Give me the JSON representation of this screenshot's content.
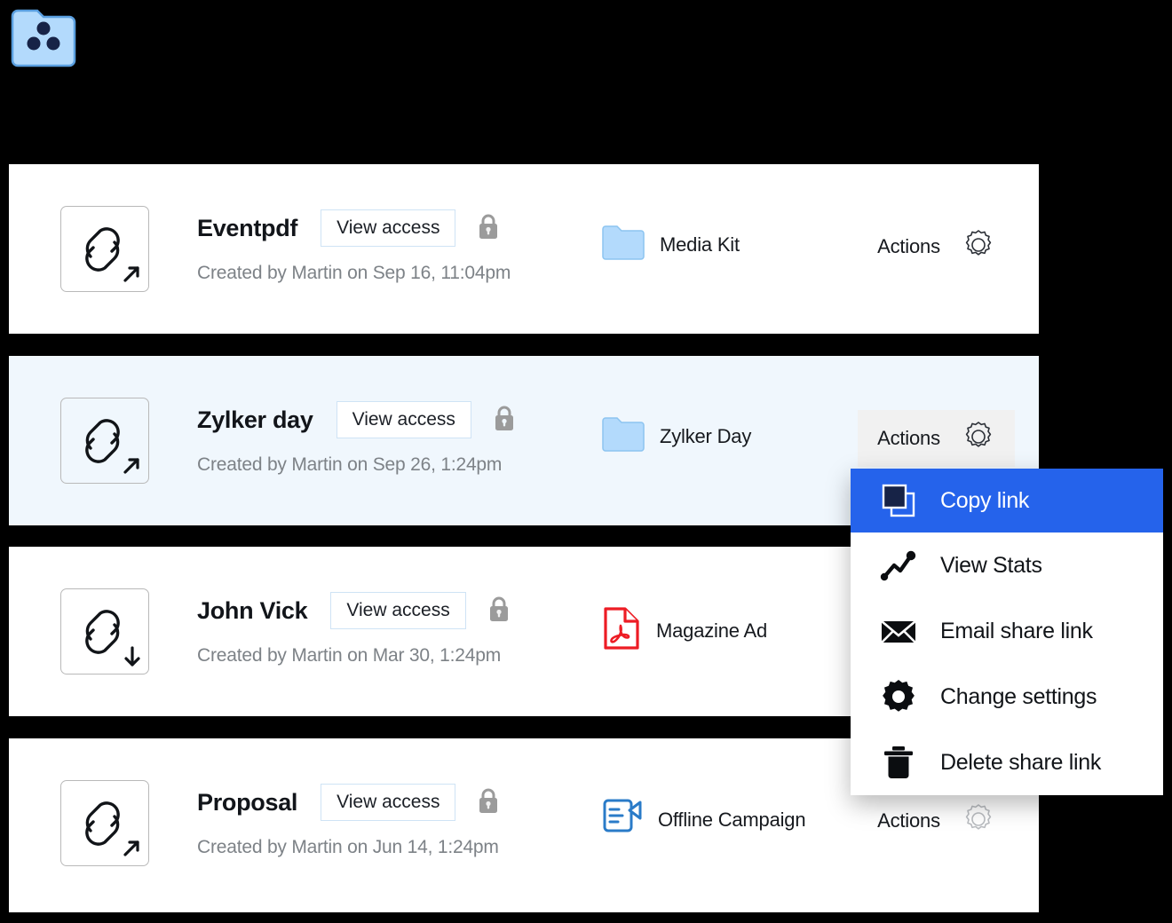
{
  "app": {
    "logo_icon": "folder-people-icon"
  },
  "menu": {
    "items": [
      {
        "label": "Copy link",
        "icon": "copy-icon",
        "highlighted": true
      },
      {
        "label": "View Stats",
        "icon": "stats-icon",
        "highlighted": false
      },
      {
        "label": "Email share link",
        "icon": "envelope-icon",
        "highlighted": false
      },
      {
        "label": "Change settings",
        "icon": "gear-icon",
        "highlighted": false
      },
      {
        "label": "Delete share link",
        "icon": "trash-icon",
        "highlighted": false
      }
    ]
  },
  "common": {
    "view_access_label": "View access",
    "actions_label": "Actions",
    "lock_icon": "lock-icon",
    "gear_icon": "gear-outline-icon"
  },
  "rows": [
    {
      "title": "Eventpdf",
      "created": "Created by Martin on Sep 16, 11:04pm",
      "link_icon": "link-external-icon",
      "resource_label": "Media Kit",
      "resource_icon": "folder-icon",
      "selected": false
    },
    {
      "title": "Zylker day",
      "created": "Created by Martin on Sep 26, 1:24pm",
      "link_icon": "link-external-icon",
      "resource_label": "Zylker Day",
      "resource_icon": "folder-icon",
      "selected": true
    },
    {
      "title": "John Vick",
      "created": "Created by Martin on Mar 30, 1:24pm",
      "link_icon": "link-download-icon",
      "resource_label": "Magazine Ad",
      "resource_icon": "pdf-icon",
      "selected": false
    },
    {
      "title": "Proposal",
      "created": "Created by Martin on Jun 14, 1:24pm",
      "link_icon": "link-external-icon",
      "resource_label": "Offline Campaign",
      "resource_icon": "campaign-icon",
      "selected": false
    }
  ],
  "colors": {
    "highlight": "#2563eb",
    "selected_row": "#f0f7fd",
    "folder_blue": "#b3dafc",
    "pdf_red": "#ed1c24",
    "campaign_blue": "#2a7bc8",
    "lock_gray": "#9b9b9b"
  }
}
